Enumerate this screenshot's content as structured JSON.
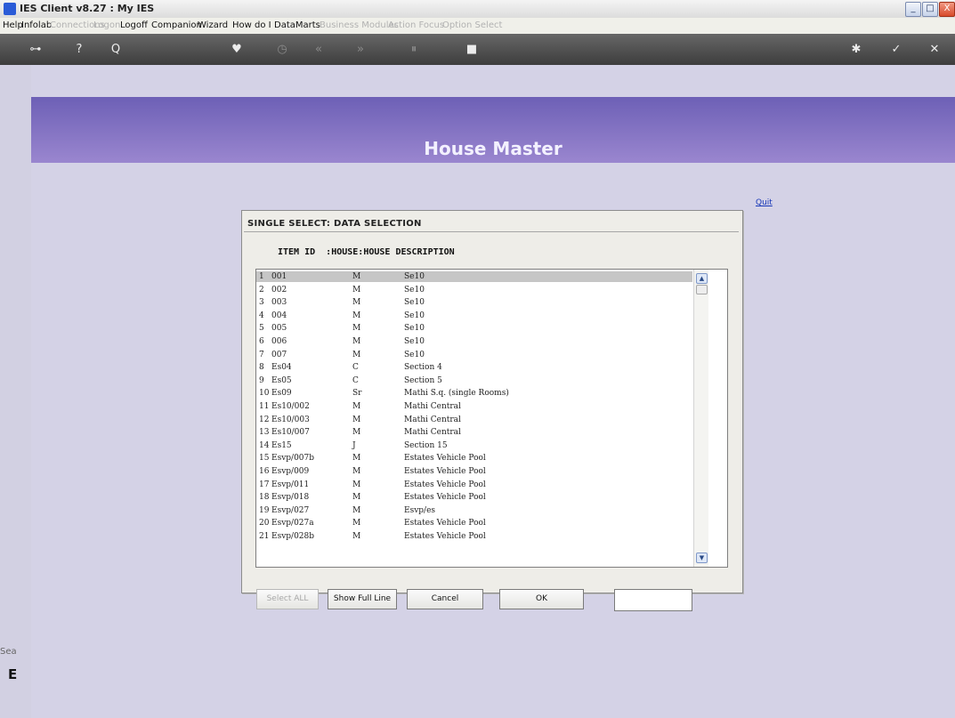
{
  "window": {
    "title": "IES Client v8.27 : My IES",
    "buttons": {
      "minimize": "_",
      "maximize": "□",
      "close": "X"
    }
  },
  "menu": [
    {
      "label": "Help",
      "enabled": true
    },
    {
      "label": "Infolab",
      "enabled": true
    },
    {
      "label": "Connections",
      "enabled": false
    },
    {
      "label": "Logon",
      "enabled": false
    },
    {
      "label": "Logoff",
      "enabled": true
    },
    {
      "label": "Companion",
      "enabled": true
    },
    {
      "label": "Wizard",
      "enabled": true
    },
    {
      "label": "How do I",
      "enabled": true
    },
    {
      "label": "DataMarts",
      "enabled": true
    },
    {
      "label": "Business Modules",
      "enabled": false
    },
    {
      "label": "Action Focus",
      "enabled": false
    },
    {
      "label": "Option Select",
      "enabled": false
    }
  ],
  "toolbar": {
    "icons": [
      "key-icon",
      "help-icon",
      "search-icon",
      "heart-icon",
      "clock-icon",
      "rewind-icon",
      "fast-forward-icon",
      "pause-icon",
      "stop-icon",
      "gear-icon",
      "check-icon",
      "close-icon"
    ],
    "glyphs": {
      "key": "⊶",
      "help": "?",
      "search": "Q",
      "heart": "♥",
      "clock": "◷",
      "rewind": "«",
      "fast_forward": "»",
      "pause": "⏸",
      "stop": "■",
      "gear": "✱",
      "check": "✓",
      "close": "✕"
    }
  },
  "page": {
    "title": "House Master",
    "quit_link": "Quit",
    "bottom_label": "Sea",
    "bottom_glyph": "E"
  },
  "dialog": {
    "title": "SINGLE SELECT: DATA SELECTION",
    "column_header": "ITEM ID  :HOUSE:HOUSE DESCRIPTION",
    "rows": [
      {
        "n": "1",
        "id": "001",
        "house": "M",
        "desc": "Se10"
      },
      {
        "n": "2",
        "id": "002",
        "house": "M",
        "desc": "Se10"
      },
      {
        "n": "3",
        "id": "003",
        "house": "M",
        "desc": "Se10"
      },
      {
        "n": "4",
        "id": "004",
        "house": "M",
        "desc": "Se10"
      },
      {
        "n": "5",
        "id": "005",
        "house": "M",
        "desc": "Se10"
      },
      {
        "n": "6",
        "id": "006",
        "house": "M",
        "desc": "Se10"
      },
      {
        "n": "7",
        "id": "007",
        "house": "M",
        "desc": "Se10"
      },
      {
        "n": "8",
        "id": "Es04",
        "house": "C",
        "desc": "Section 4"
      },
      {
        "n": "9",
        "id": "Es05",
        "house": "C",
        "desc": "Section 5"
      },
      {
        "n": "10",
        "id": "Es09",
        "house": "Sr",
        "desc": "Mathi S.q. (single Rooms)"
      },
      {
        "n": "11",
        "id": "Es10/002",
        "house": "M",
        "desc": "Mathi Central"
      },
      {
        "n": "12",
        "id": "Es10/003",
        "house": "M",
        "desc": "Mathi Central"
      },
      {
        "n": "13",
        "id": "Es10/007",
        "house": "M",
        "desc": "Mathi Central"
      },
      {
        "n": "14",
        "id": "Es15",
        "house": "J",
        "desc": "Section 15"
      },
      {
        "n": "15",
        "id": "Esvp/007b",
        "house": "M",
        "desc": "Estates Vehicle Pool"
      },
      {
        "n": "16",
        "id": "Esvp/009",
        "house": "M",
        "desc": "Estates Vehicle Pool"
      },
      {
        "n": "17",
        "id": "Esvp/011",
        "house": "M",
        "desc": "Estates Vehicle Pool"
      },
      {
        "n": "18",
        "id": "Esvp/018",
        "house": "M",
        "desc": "Estates Vehicle Pool"
      },
      {
        "n": "19",
        "id": "Esvp/027",
        "house": "M",
        "desc": "Esvp/es"
      },
      {
        "n": "20",
        "id": "Esvp/027a",
        "house": "M",
        "desc": "Estates Vehicle Pool"
      },
      {
        "n": "21",
        "id": "Esvp/028b",
        "house": "M",
        "desc": "Estates Vehicle Pool"
      }
    ],
    "selected_row": 0,
    "scroll": {
      "up": "▲",
      "down": "▼"
    },
    "buttons": {
      "select_all": "Select ALL",
      "show_full_line": "Show Full Line",
      "cancel": "Cancel",
      "ok": "OK"
    },
    "input_value": ""
  }
}
